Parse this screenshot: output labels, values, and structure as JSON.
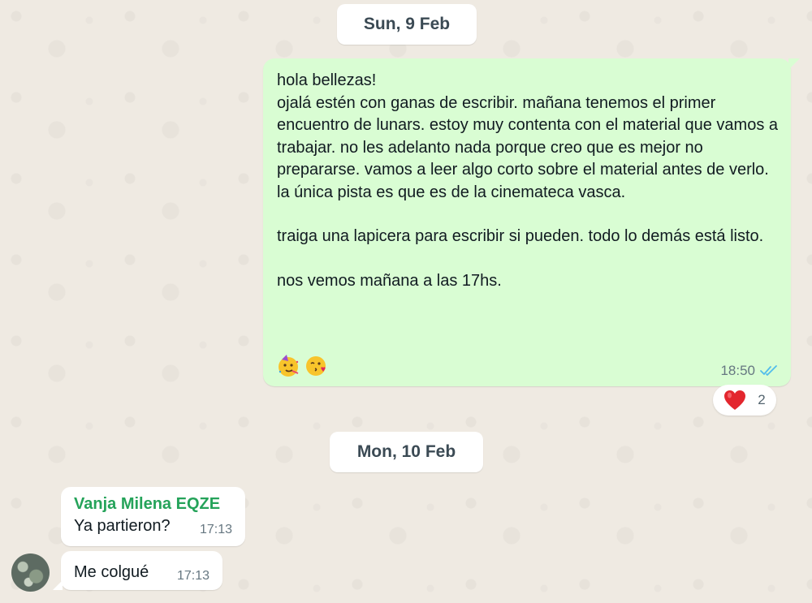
{
  "chat": {
    "date_1": "Sun, 9 Feb",
    "date_2": "Mon, 10 Feb",
    "outgoing": {
      "p1": "hola bellezas!\nojalá estén con ganas de escribir. mañana tenemos el primer encuentro de lunars. estoy muy contenta con el material que vamos a trabajar. no les adelanto nada porque creo que es mejor no prepararse. vamos a leer algo corto sobre el material antes de verlo. la única pista es que es de la cinemateca vasca.",
      "p2": "traiga una lapicera para escribir si pueden. todo lo demás está listo.",
      "p3": "nos vemos mañana a las 17hs.",
      "emojis": [
        "party-face-emoji",
        "kissing-face-emoji"
      ],
      "time": "18:50",
      "status_icon": "double-check-icon",
      "status_color": "#53bdeb",
      "bubble_color": "#d9fdd3"
    },
    "reaction": {
      "emoji": "red-heart-emoji",
      "count": "2"
    },
    "incoming": [
      {
        "sender": "Vanja Milena EQZE",
        "text": "Ya partieron?",
        "time": "17:13"
      },
      {
        "text": "Me colgué",
        "time": "17:13"
      }
    ],
    "sender_color": "#25a35a",
    "background_color": "#efeae2"
  }
}
